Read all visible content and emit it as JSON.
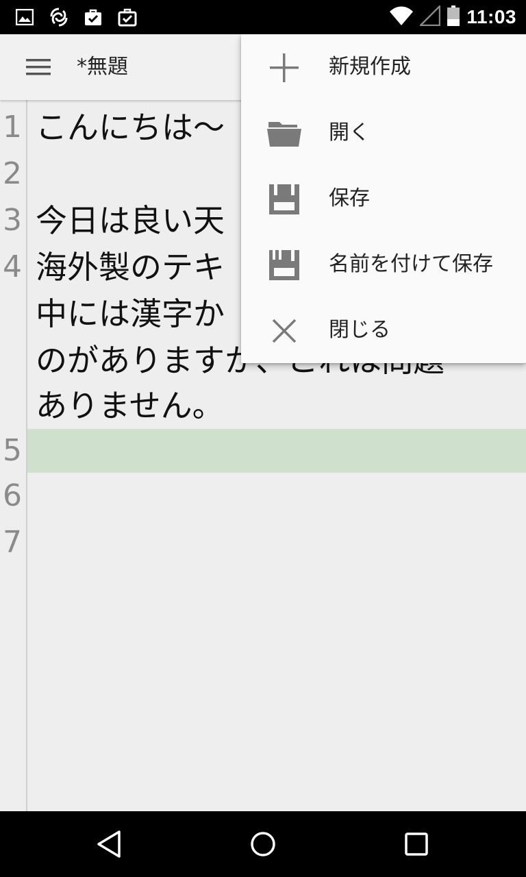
{
  "status_bar": {
    "time": "11:03",
    "icons_left": [
      "image-notification-icon",
      "sync-notification-icon",
      "task-check-icon",
      "task-clipboard-icon"
    ],
    "icons_right": [
      "wifi-icon",
      "cell-signal-icon",
      "battery-icon"
    ]
  },
  "app_bar": {
    "title": "*無題"
  },
  "editor": {
    "line_numbers": [
      "1",
      "2",
      "3",
      "4",
      "5",
      "6",
      "7"
    ],
    "visible_text": [
      "こんにちは〜",
      "",
      "今日は良い天",
      "海外製のテキ",
      "中には漢字か",
      "のがありますか、これは問題",
      "ありません。"
    ],
    "current_line": "5",
    "current_line_color": "#cfe1cd"
  },
  "menu": {
    "items": [
      {
        "label": "新規作成",
        "icon": "plus-icon"
      },
      {
        "label": "開く",
        "icon": "folder-open-icon"
      },
      {
        "label": "保存",
        "icon": "save-icon"
      },
      {
        "label": "名前を付けて保存",
        "icon": "save-as-icon"
      },
      {
        "label": "閉じる",
        "icon": "close-icon"
      }
    ]
  },
  "nav_bar": {
    "buttons": [
      "back-icon",
      "home-icon",
      "recents-icon"
    ]
  },
  "colors": {
    "icon_gray": "#7a7a7a",
    "background": "#eeeeee",
    "menu_background": "#fafafa"
  }
}
